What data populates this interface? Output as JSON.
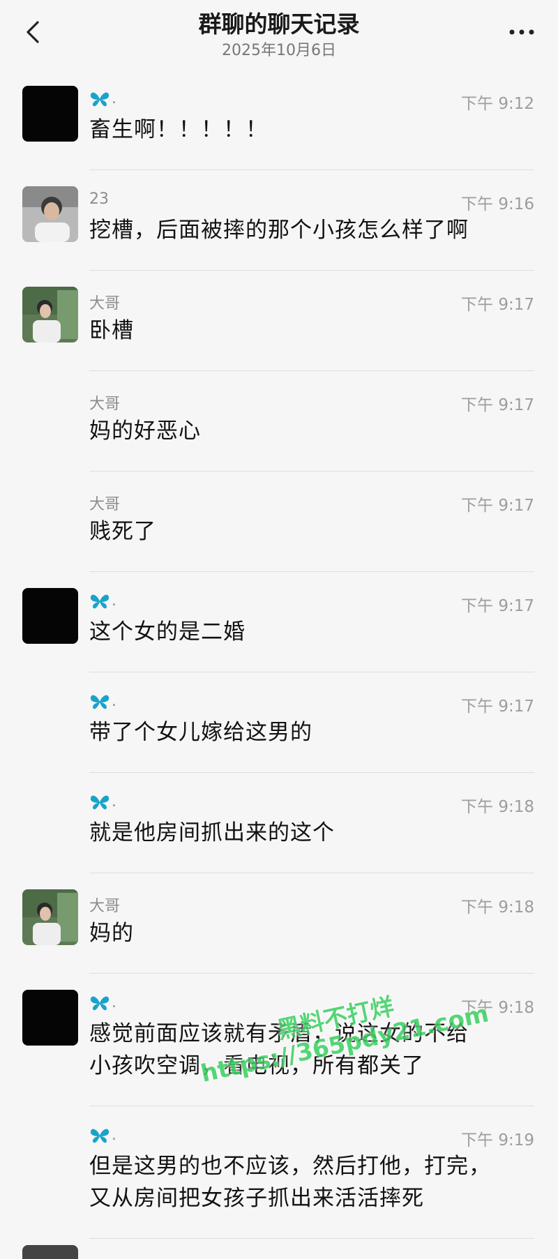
{
  "header": {
    "title": "群聊的聊天记录",
    "date": "2025年10月6日"
  },
  "messages": [
    {
      "sender": "",
      "butterfly": true,
      "time": "下午 9:12",
      "text": "畜生啊！！！！！",
      "avatar": "black"
    },
    {
      "sender": "23",
      "butterfly": false,
      "time": "下午 9:16",
      "text": "挖槽，后面被摔的那个小孩怎么样了啊",
      "avatar": "photo"
    },
    {
      "sender": "大哥",
      "butterfly": false,
      "time": "下午 9:17",
      "text": "卧槽",
      "avatar": "photo"
    },
    {
      "sender": "大哥",
      "butterfly": false,
      "time": "下午 9:17",
      "text": "妈的好恶心",
      "avatar": ""
    },
    {
      "sender": "大哥",
      "butterfly": false,
      "time": "下午 9:17",
      "text": "贱死了",
      "avatar": ""
    },
    {
      "sender": "",
      "butterfly": true,
      "time": "下午 9:17",
      "text": "这个女的是二婚",
      "avatar": "black"
    },
    {
      "sender": "",
      "butterfly": true,
      "time": "下午 9:17",
      "text": "带了个女儿嫁给这男的",
      "avatar": ""
    },
    {
      "sender": "",
      "butterfly": true,
      "time": "下午 9:18",
      "text": "就是他房间抓出来的这个",
      "avatar": ""
    },
    {
      "sender": "大哥",
      "butterfly": false,
      "time": "下午 9:18",
      "text": "妈的",
      "avatar": "photo"
    },
    {
      "sender": "",
      "butterfly": true,
      "time": "下午 9:18",
      "text": "感觉前面应该就有矛盾，说这女的不给\n小孩吹空调，看电视，所有都关了",
      "avatar": "black"
    },
    {
      "sender": "",
      "butterfly": true,
      "time": "下午 9:19",
      "text": "但是这男的也不应该，然后打他，打完，\n又从房间把女孩子抓出来活活摔死",
      "avatar": ""
    }
  ],
  "watermark": {
    "line1": "黑料不打烊",
    "line2": "https://365pdy21.com"
  },
  "colors": {
    "background": "#f6f6f6",
    "butterfly": "#1aa3c9",
    "watermark": "#3ad060"
  }
}
